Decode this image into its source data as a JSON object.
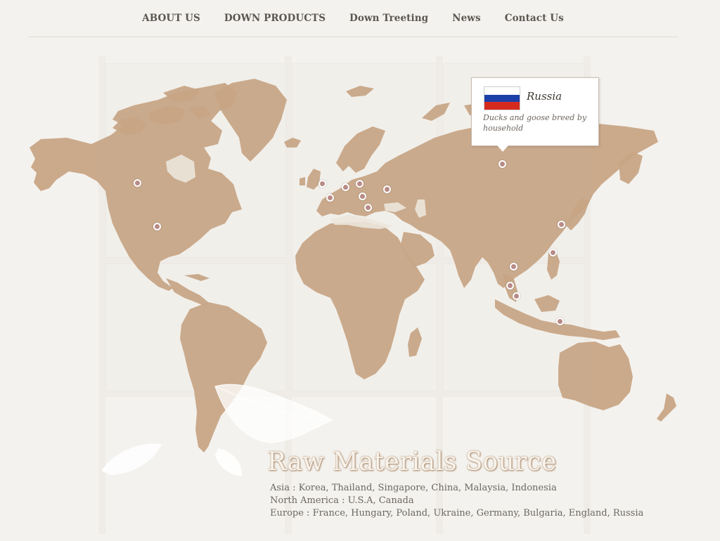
{
  "nav": {
    "items": [
      "ABOUT US",
      "DOWN PRODUCTS",
      "Down Treeting",
      "News",
      "Contact Us"
    ]
  },
  "tooltip": {
    "country": "Russia",
    "description": "Ducks and goose breed by household",
    "flag_colors": [
      "#ffffff",
      "#1c3fa8",
      "#d52b1e"
    ]
  },
  "colors": {
    "land": "#c7a584",
    "pin": "#b98b87",
    "background": "#f4f2ee"
  },
  "title": "Raw Materials Source",
  "regions": [
    "Asia : Korea, Thailand, Singapore, China, Malaysia, Indonesia",
    "North America : U.S.A, Canada",
    "Europe : France, Hungary, Poland, Ukraine, Germany, Bulgaria, England, Russia"
  ]
}
